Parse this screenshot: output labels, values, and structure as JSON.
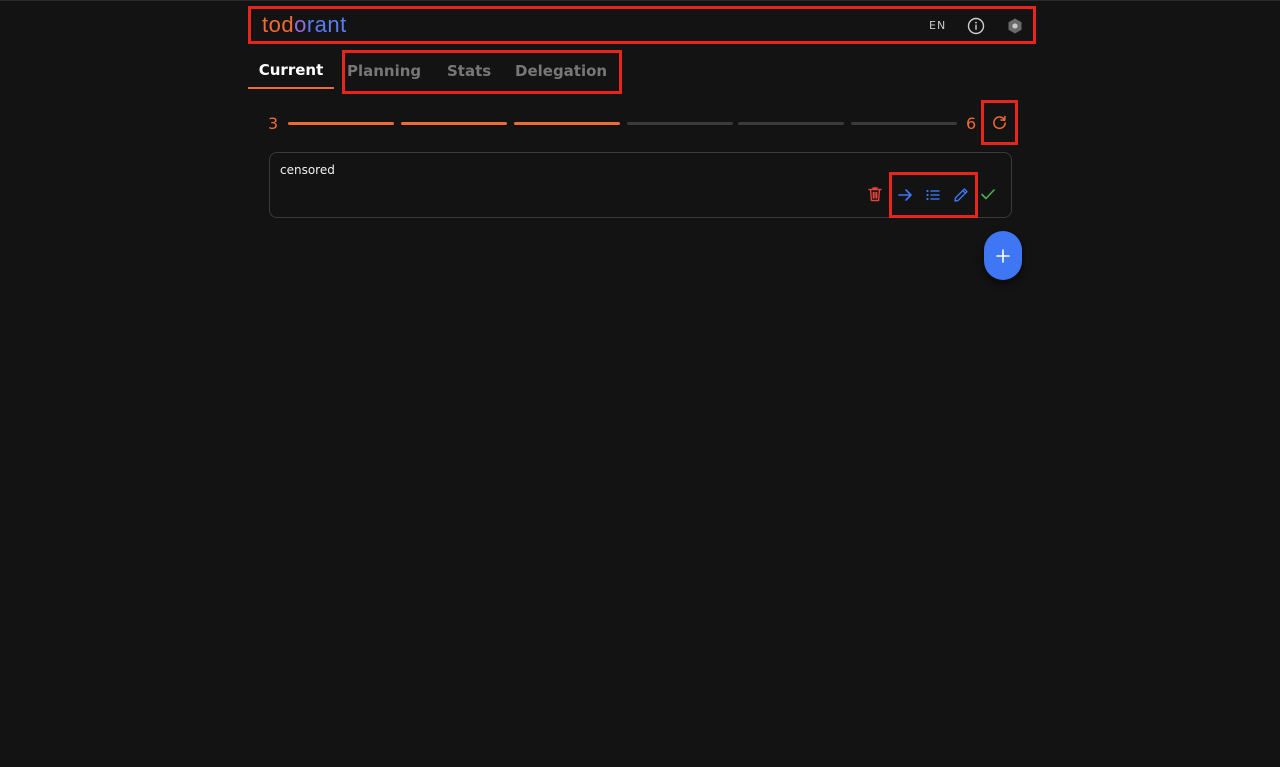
{
  "header": {
    "logo": {
      "part1": "tod",
      "part2": "o",
      "part3": "rant"
    },
    "language": "EN",
    "info_icon": "info-icon",
    "settings_icon": "hexagon-icon"
  },
  "tabs": [
    {
      "label": "Current",
      "active": true
    },
    {
      "label": "Planning",
      "active": false
    },
    {
      "label": "Stats",
      "active": false
    },
    {
      "label": "Delegation",
      "active": false
    }
  ],
  "progress": {
    "completed": "3",
    "total": "6",
    "segments_done": 3,
    "segments_total": 6
  },
  "todo": {
    "text": "censored",
    "actions": [
      "delete-icon",
      "move-forward-icon",
      "list-icon",
      "edit-icon",
      "complete-icon"
    ]
  },
  "colors": {
    "accent": "#f06a35",
    "primary": "#3e76f3",
    "danger": "#e0443a",
    "success": "#4caf50",
    "highlight": "#e8251a"
  }
}
